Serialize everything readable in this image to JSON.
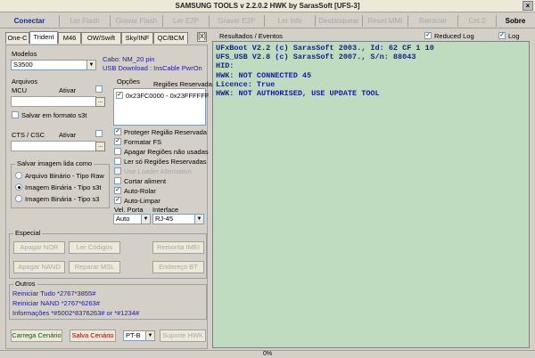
{
  "window": {
    "title": "SAMSUNG TOOLS v 2.2.0.2 HWK by SarasSoft  [UFS-3]",
    "close_glyph": "×"
  },
  "menu": [
    {
      "label": "Conectar",
      "state": "active"
    },
    {
      "label": "Ler Flash",
      "state": "disabled"
    },
    {
      "label": "Gravar Flash",
      "state": "disabled"
    },
    {
      "label": "Ler E2P",
      "state": "disabled"
    },
    {
      "label": "Gravar E2P",
      "state": "disabled"
    },
    {
      "label": "Ler Info",
      "state": "disabled"
    },
    {
      "label": "Desbloquear",
      "state": "disabled"
    },
    {
      "label": "Reset MMI",
      "state": "disabled"
    },
    {
      "label": "Reiniciar",
      "state": "disabled"
    },
    {
      "label": "Cnt.0",
      "state": "disabled"
    },
    {
      "label": "Sobre",
      "state": "bold"
    }
  ],
  "tabs": [
    "One-C",
    "Trident",
    "M46",
    "OW/Swift",
    "Sky/INF",
    "QC/BCM"
  ],
  "selected_tab": "Trident",
  "tab_close_glyph": "[X]",
  "modelos": {
    "title": "Modelos",
    "value": "S3500"
  },
  "cabo": {
    "line1": "Cabo: NM_20 pin",
    "line2": "USB Download :  InsCable PwrOn"
  },
  "arquivos": {
    "title": "Arquivos",
    "mcu_label": "MCU",
    "ativar_label": "Ativar",
    "save_s3t": "Salvar em formato s3t",
    "cts_label": "CTS / CSC",
    "browse_glyph": "..."
  },
  "salvar_imagem": {
    "title": "Salvar imagem lida como",
    "options": [
      "Arquivo Binário - Tipo Raw",
      "Imagem Binária - Tipo s3t",
      "Imagem Binária - Tipo s3"
    ],
    "selected": 1
  },
  "opcoes": {
    "title": "Opções",
    "regions_header": "Regiões Reservadas",
    "region_item": "0x23FC0000 - 0x23FFFFFF",
    "checks": [
      {
        "label": "Proteger Região Reservada",
        "checked": true,
        "enabled": true
      },
      {
        "label": "Formatar FS",
        "checked": true,
        "enabled": true
      },
      {
        "label": "Apagar Regiões não usadas",
        "checked": false,
        "enabled": true
      },
      {
        "label": "Ler só Regiões Reservadas",
        "checked": false,
        "enabled": true
      },
      {
        "label": "Use Loader Alternativo",
        "checked": false,
        "enabled": false
      },
      {
        "label": "Cortar aliment",
        "checked": false,
        "enabled": true
      },
      {
        "label": "Auto-Rolar",
        "checked": true,
        "enabled": true
      },
      {
        "label": "Auto-Limpar",
        "checked": true,
        "enabled": true
      }
    ],
    "vel_porta_label": "Vel. Porta",
    "vel_porta_value": "Auto",
    "interface_label": "Interface",
    "interface_value": "RJ-45"
  },
  "especial": {
    "title": "Especial",
    "buttons": [
      "Apagar NOR",
      "Ler Códigos",
      "Remonta IMEI",
      "Apagar NAND",
      "Reparar MSL",
      "Endereço BT"
    ]
  },
  "outros": {
    "title": "Outros",
    "lines": [
      "Reiniciar Tudo  *2767*3855#",
      "Reiniciar NAND  *2767*6263#",
      "Informações  *#5002*8376263#  or *#1234#"
    ]
  },
  "bottom_buttons": {
    "carrega": "Carrega Cenário",
    "salva": "Salva Cenário",
    "ptb": "PT-B",
    "suporte": "Suporte HWK"
  },
  "resultados": {
    "title": "Resultados / Eventos",
    "reduced_log": "Reduced Log",
    "log": "Log",
    "lines": [
      "UFxBoot V2.2 (c) SarasSoft 2003., Id: 62 CF 1 10",
      "UFS_USB V2.8 (c) SarasSoft 2007., S/n: 88043",
      "HID:",
      "HWK: NOT CONNECTED 45",
      "Licence: True",
      "HWK: NOT AUTHORISED, USE UPDATE TOOL"
    ]
  },
  "status": {
    "progress": "0%"
  },
  "colors": {
    "log_bg": "#c0dcc0",
    "log_text": "#1a1aa0",
    "active_menu": "#1b2f8a"
  }
}
